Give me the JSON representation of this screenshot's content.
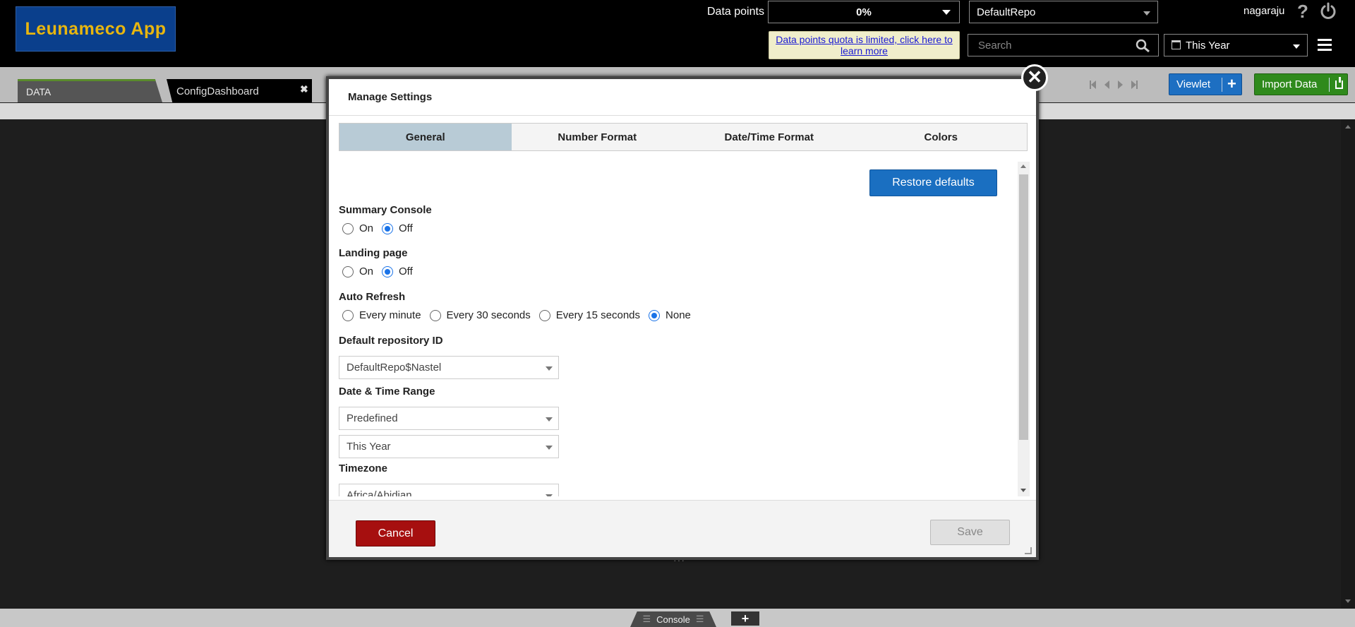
{
  "app": {
    "logo_text": "Leunameco App"
  },
  "header": {
    "data_points_label": "Data points",
    "data_points_value": "0%",
    "repository": "DefaultRepo",
    "username": "nagaraju",
    "quota_notice": "Data points quota is limited, click here to learn more",
    "search_placeholder": "Search",
    "time_range": "This Year"
  },
  "tabs": {
    "items": [
      {
        "label": "DATA"
      },
      {
        "label": "ConfigDashboard"
      }
    ],
    "viewlet_label": "Viewlet",
    "import_label": "Import Data"
  },
  "modal": {
    "title": "Manage Settings",
    "tabs": [
      "General",
      "Number Format",
      "Date/Time Format",
      "Colors"
    ],
    "active_tab": "General",
    "restore_label": "Restore defaults",
    "summary_console": {
      "label": "Summary Console",
      "options": [
        "On",
        "Off"
      ],
      "selected": "Off"
    },
    "landing_page": {
      "label": "Landing page",
      "options": [
        "On",
        "Off"
      ],
      "selected": "Off"
    },
    "auto_refresh": {
      "label": "Auto Refresh",
      "options": [
        "Every minute",
        "Every 30 seconds",
        "Every 15 seconds",
        "None"
      ],
      "selected": "None"
    },
    "default_repo": {
      "label": "Default repository ID",
      "value": "DefaultRepo$Nastel"
    },
    "date_time_range": {
      "label": "Date & Time Range",
      "type_value": "Predefined",
      "range_value": "This Year"
    },
    "timezone": {
      "label": "Timezone",
      "value": "Africa/Abidjan"
    },
    "cancel_label": "Cancel",
    "save_label": "Save"
  },
  "footer": {
    "console_label": "Console"
  },
  "colors": {
    "logo_bg": "#0a3f8c",
    "logo_text": "#e8b60f",
    "viewlet_btn": "#1d6fc2",
    "import_btn": "#2f8a1c",
    "restore_btn": "#1a6fc1",
    "cancel_btn": "#a60f0f",
    "active_tab": "#b8cbd6"
  },
  "icons": [
    "help-icon",
    "power-icon",
    "search-icon",
    "calendar-icon",
    "menu-icon",
    "close-icon",
    "plus-icon",
    "import-icon"
  ]
}
